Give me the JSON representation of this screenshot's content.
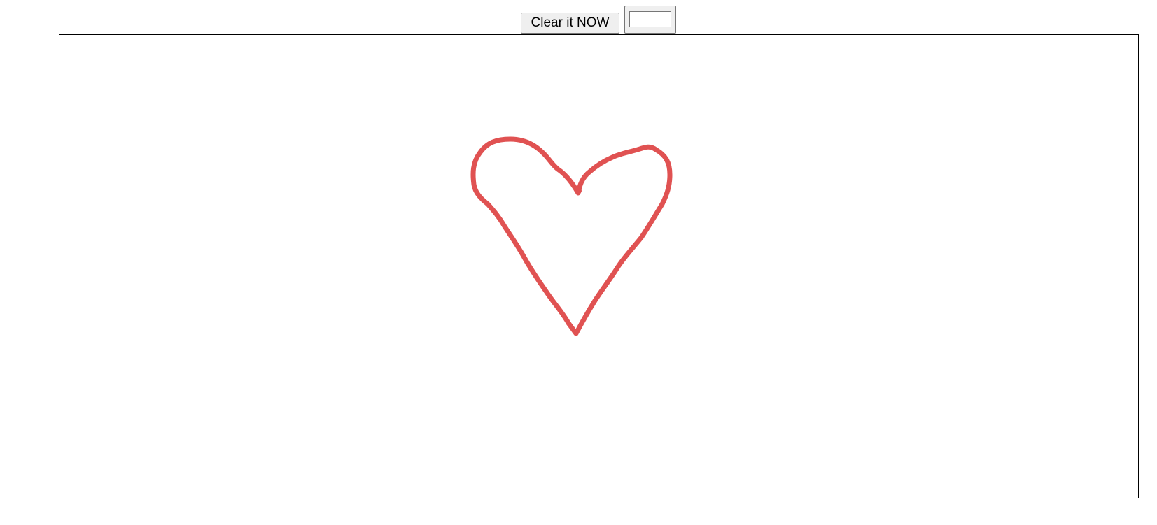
{
  "toolbar": {
    "clear_label": "Clear it NOW",
    "color_value": "#ffffff"
  },
  "canvas": {
    "stroke_color": "#e05252",
    "drawing": "heart"
  }
}
